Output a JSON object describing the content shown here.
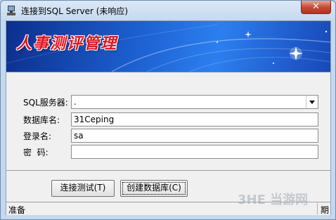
{
  "window": {
    "title": "连接到SQL Server (未响应)"
  },
  "banner": {
    "title": "人事测评管理"
  },
  "form": {
    "rows": [
      {
        "label": "SQL服务器:",
        "value": "."
      },
      {
        "label": "数据库名:",
        "value": "31Ceping"
      },
      {
        "label": "登录名:",
        "value": "sa"
      },
      {
        "label": "密  码:",
        "value": ""
      }
    ]
  },
  "buttons": {
    "test": "连接测试(T)",
    "create": "创建数据库(C)"
  },
  "statusbar": {
    "left": "准备",
    "right": "期"
  },
  "watermark": {
    "text": "3HE 当游网"
  },
  "icons": {
    "app": "computer-icon",
    "close": "close-icon",
    "dropdown": "chevron-down-icon"
  }
}
